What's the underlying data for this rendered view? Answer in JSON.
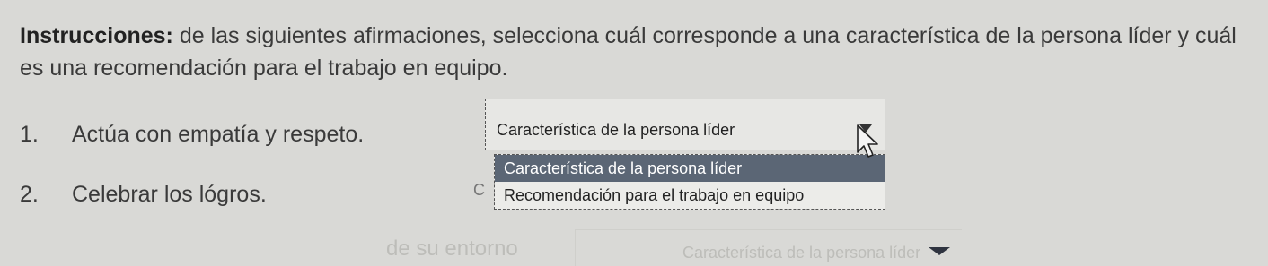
{
  "instructions": {
    "label": "Instrucciones:",
    "text": " de las siguientes afirmaciones, selecciona cuál corresponde a una característica de la persona líder y cuál es una recomendación para el trabajo en equipo."
  },
  "questions": [
    {
      "number": "1.",
      "text": "Actúa con empatía y respeto."
    },
    {
      "number": "2.",
      "text": "Celebrar los lógros."
    }
  ],
  "select": {
    "value": "Característica de la persona líder",
    "arrow_icon": "triangle-down-icon"
  },
  "dropdown": {
    "options": [
      {
        "label": "Característica de la persona líder",
        "selected": true
      },
      {
        "label": "Recomendación para el trabajo en equipo",
        "selected": false
      }
    ]
  },
  "partial_prefix": "C",
  "cursor_icon": "mouse-pointer-icon",
  "faded_row": {
    "left_text": "de su entorno",
    "right_text": "Característica de la persona líder"
  },
  "colors": {
    "background": "#d9d9d6",
    "highlight": "#5b6675"
  }
}
